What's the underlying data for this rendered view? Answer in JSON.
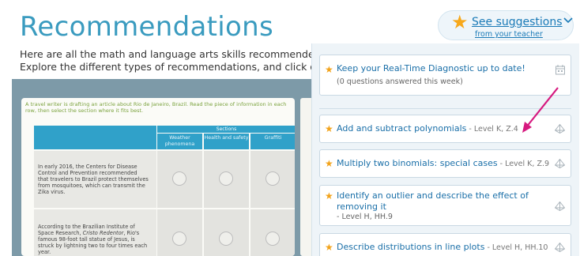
{
  "page": {
    "title": "Recommendations",
    "intro_line1": "Here are all the math and language arts skills recommended just fo",
    "intro_line2": "Explore the different types of recommendations, and click on any s"
  },
  "suggestions_toggle": {
    "main_label": "See suggestions",
    "sub_label": "from your teacher",
    "star_icon": "star-icon",
    "chevron_icon": "chevron-down-icon"
  },
  "panel": {
    "diagnostic": {
      "title": "Keep your Real-Time Diagnostic up to date!",
      "subtitle": "(0 questions answered this week)",
      "icon": "calendar-icon"
    },
    "items": [
      {
        "title": "Add and subtract polynomials",
        "level": " - Level K, Z.4",
        "icon": "pyramid-icon"
      },
      {
        "title": "Multiply two binomials: special cases",
        "level": " - Level K, Z.9",
        "icon": "pyramid-icon"
      },
      {
        "title": "Identify an outlier and describe the effect of removing it",
        "level": "- Level H, HH.9",
        "icon": "pyramid-icon"
      },
      {
        "title": "Describe distributions in line plots",
        "level": " - Level H, HH.10",
        "icon": "pyramid-icon"
      }
    ]
  },
  "preview": {
    "instructions": "A travel writer is drafting an article about Rio de Janeiro, Brazil. Read the piece of information in each row, then select the section where it fits best.",
    "sections_label": "Sections",
    "columns": [
      "Weather phenomena",
      "Health and safety",
      "Graffiti"
    ],
    "rows": [
      {
        "text": "In early 2016, the Centers for Disease Control and Prevention recommended that travelers to Brazil protect themselves from mosquitoes, which can transmit the Zika virus."
      },
      {
        "text_before": "According to the Brazilian Institute of Space Research, ",
        "text_em": "Cristo Redentor",
        "text_after": ", Rio's famous 98-foot tall statue of Jesus, is struck by lightning two to four times each year."
      }
    ]
  },
  "colors": {
    "title_blue": "#3a9bbf",
    "link_blue": "#1a6fa8",
    "star_orange": "#f2a31b",
    "arrow_magenta": "#d6197f",
    "table_header": "#30a1c9",
    "instruction_green": "#7aa23d"
  }
}
